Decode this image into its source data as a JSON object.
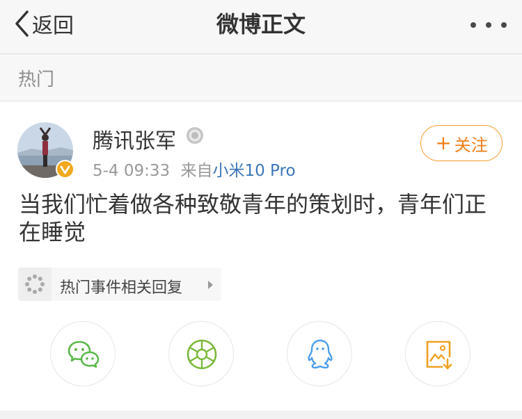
{
  "nav": {
    "back_label": "返回",
    "title": "微博正文",
    "more_icon": "more-icon"
  },
  "section": {
    "label": "热门"
  },
  "post": {
    "username": "腾讯张军",
    "time": "5-4 09:33",
    "source_prefix": "来自",
    "device": "小米10 Pro",
    "follow_label": "关注",
    "text": "当我们忙着做各种致敬青年的策划时，青年们正在睡觉",
    "verified_badge_color": "#f3a81f"
  },
  "topic": {
    "label": "热门事件相关回复"
  },
  "share": {
    "buttons": [
      {
        "icon": "wechat-icon",
        "color": "#5bb84a"
      },
      {
        "icon": "moments-icon",
        "color": "#7ab83a"
      },
      {
        "icon": "qq-icon",
        "color": "#4c9ee8"
      },
      {
        "icon": "save-image-icon",
        "color": "#f0a020"
      }
    ]
  },
  "colors": {
    "accent": "#f07d16",
    "link": "#3b76b8"
  }
}
